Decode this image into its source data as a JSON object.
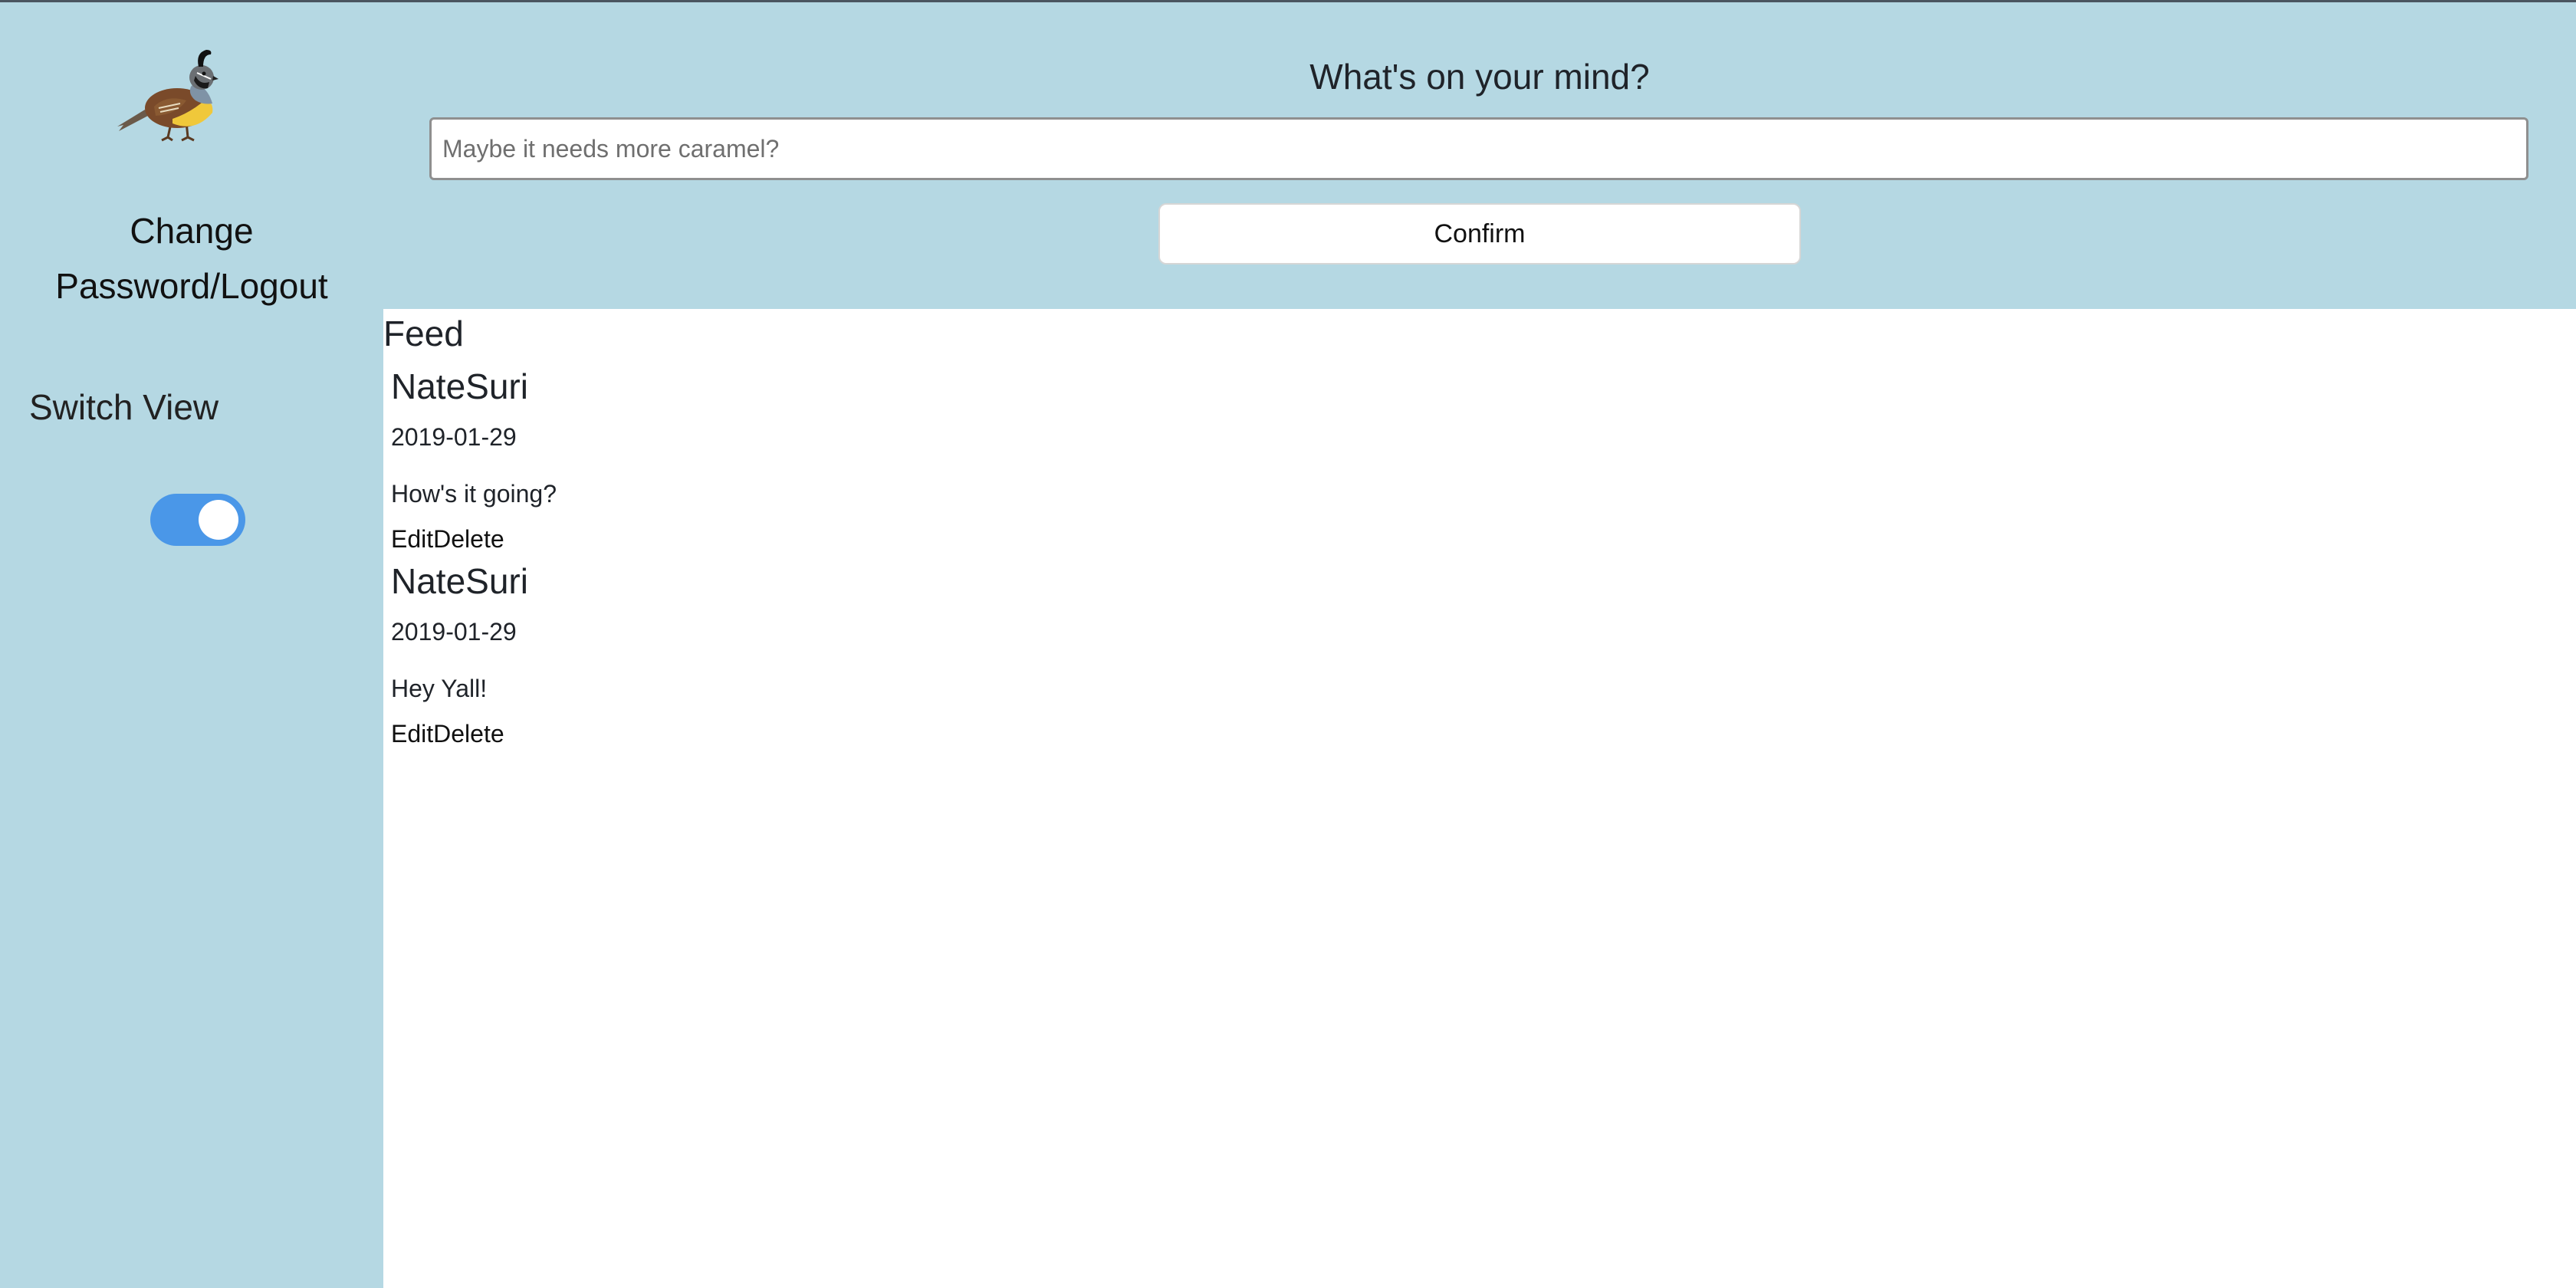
{
  "sidebar": {
    "logo_icon": "quail-bird-icon",
    "change_password_logout_line1": "Change",
    "change_password_logout_line2": "Password/Logout",
    "switch_view_label": "Switch View",
    "switch_view_on": true
  },
  "compose": {
    "title": "What's on your mind?",
    "placeholder": "Maybe it needs more caramel?",
    "value": "",
    "confirm_label": "Confirm"
  },
  "feed": {
    "title": "Feed",
    "posts": [
      {
        "author": "NateSuri",
        "date": "2019-01-29",
        "text": "How's it going?",
        "edit_label": "Edit",
        "delete_label": "Delete"
      },
      {
        "author": "NateSuri",
        "date": "2019-01-29",
        "text": "Hey Yall!",
        "edit_label": "Edit",
        "delete_label": "Delete"
      }
    ]
  },
  "colors": {
    "background": "#b5d8e3",
    "feed_background": "#ffffff",
    "toggle_on": "#4a97e8"
  }
}
